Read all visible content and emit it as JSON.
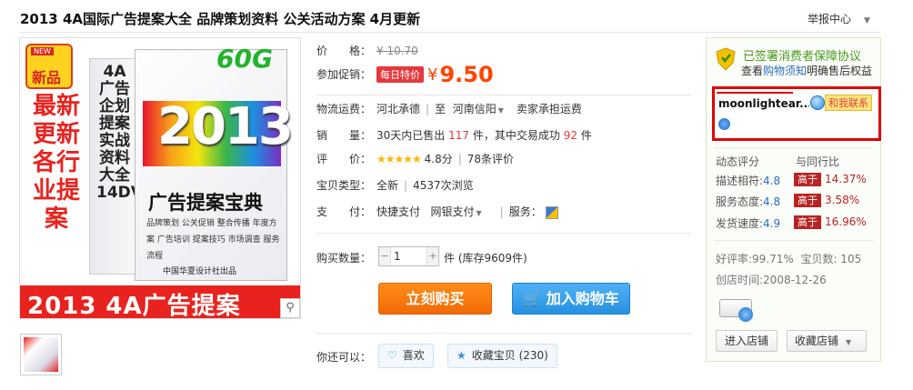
{
  "header": {
    "title": "2013 4A国际广告提案大全 品牌策划资料 公关活动方案 4月更新",
    "report": "举报中心"
  },
  "image": {
    "badge_tag": "NEW",
    "badge_text": "新品",
    "left_text": "最新更新 各行业提案",
    "size": "60G",
    "year": "2013",
    "box_title": "广告提案宝典",
    "box_sub": "品牌策划 公关促销 整合传播 年度方案 广告培训 提案技巧 市场调查 服务流程",
    "side_text": "4A广告企划提案实战资料大全14DVD",
    "publisher": "中国华夏设计社出品",
    "banner": "2013 4A广告提案",
    "zoom_icon": "magnifier-icon"
  },
  "info": {
    "price_label": "价　　格：",
    "price_original": "¥ 10.70",
    "promo_label": "参加促销：",
    "promo_tag": "每日特价",
    "promo_currency": "¥",
    "promo_price": "9.50",
    "shipping_label": "物流运费：",
    "ship_from": "河北承德",
    "ship_to_prefix": "至",
    "ship_to": "河南信阳",
    "ship_fee": "卖家承担运费",
    "sales_label": "销　　量：",
    "sales_pre": "30天内已售出",
    "sales_count": "117",
    "sales_mid": "件，其中交易成功",
    "sales_success": "92",
    "sales_post": "件",
    "rating_label": "评　　价：",
    "stars": "★★★★★",
    "rating_score": "4.8分",
    "rating_count": "78条评价",
    "type_label": "宝贝类型：",
    "type_value": "全新",
    "views": "4537次浏览",
    "pay_label": "支　　付：",
    "pay_quick": "快捷支付",
    "pay_bank": "网银支付",
    "service_label": "服务：",
    "qty_label": "购买数量：",
    "qty_value": "1",
    "qty_stock": "件 (库存9609件)",
    "buy_now": "立刻购买",
    "add_cart": "加入购物车",
    "also_label": "你还可以：",
    "like": "喜欢",
    "collect": "收藏宝贝 (230)"
  },
  "panel": {
    "guard_title": "已签署消费者保障协议",
    "guard_pre": "查看",
    "guard_link": "购物须知",
    "guard_post": "明确售后权益",
    "seller": "moonlightear...",
    "contact": "和我联系",
    "dyn_title": "动态评分",
    "compare_title": "与同行比",
    "metrics": [
      {
        "label": "描述相符:",
        "value": "4.8",
        "badge": "高于",
        "pct": "14.37%"
      },
      {
        "label": "服务态度:",
        "value": "4.8",
        "badge": "高于",
        "pct": "3.58%"
      },
      {
        "label": "发货速度:",
        "value": "4.9",
        "badge": "高于",
        "pct": "16.96%"
      }
    ],
    "good_rate": "好评率:99.71%",
    "items_count": "宝贝数: 105",
    "created": "创店时间:2008-12-26",
    "enter_shop": "进入店铺",
    "fav_shop": "收藏店铺"
  }
}
